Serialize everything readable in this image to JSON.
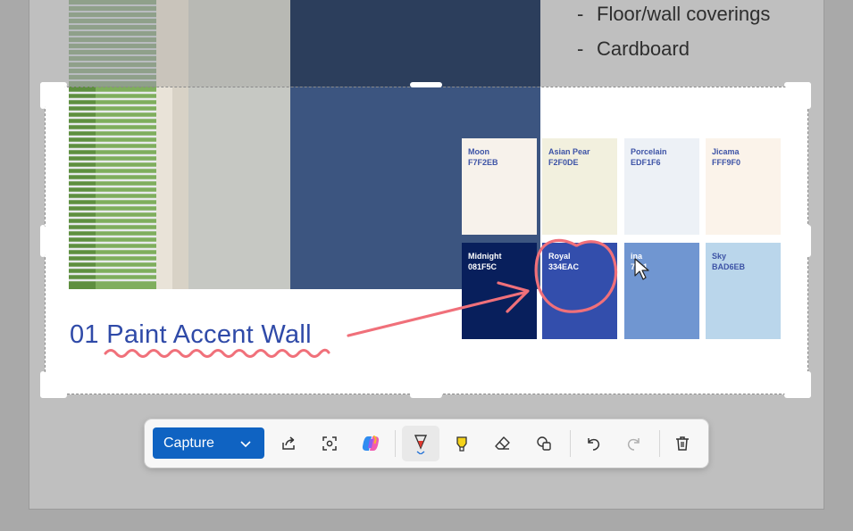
{
  "document": {
    "bullets": [
      {
        "dash": "-",
        "text": "Floor/wall coverings"
      },
      {
        "dash": "-",
        "text": "Cardboard"
      }
    ]
  },
  "selection": {
    "heading": "01 Paint Accent Wall",
    "swatches": [
      {
        "name": "Moon",
        "hex": "F7F2EB",
        "color": "#f7f2eb",
        "text_color": "#3d53a6"
      },
      {
        "name": "Asian Pear",
        "hex": "F2F0DE",
        "color": "#f2f0de",
        "text_color": "#3d53a6"
      },
      {
        "name": "Porcelain",
        "hex": "EDF1F6",
        "color": "#edf1f6",
        "text_color": "#3d53a6"
      },
      {
        "name": "Jicama",
        "hex": "FFF9F0",
        "color": "#fbf3ea",
        "text_color": "#3d53a6"
      },
      {
        "name": "Midnight",
        "hex": "081F5C",
        "color": "#081f5c",
        "text_color": "#ffffff"
      },
      {
        "name": "Royal",
        "hex": "334EAC",
        "color": "#334eac",
        "text_color": "#ffffff"
      },
      {
        "name": "ina",
        "hex": "7  D1",
        "color": "#7096d1",
        "text_color": "#ffffff"
      },
      {
        "name": "Sky",
        "hex": "BAD6EB",
        "color": "#bad6eb",
        "text_color": "#3d53a6"
      }
    ]
  },
  "toolbar": {
    "capture_label": "Capture",
    "buttons": [
      "share-icon",
      "visual-search-icon",
      "copilot-icon",
      "pen-icon",
      "highlighter-icon",
      "eraser-icon",
      "shapes-icon",
      "undo-icon",
      "redo-icon",
      "delete-icon"
    ]
  },
  "colors": {
    "accent": "#0f63c2",
    "annotation": "#f0707a",
    "heading": "#2f4aa8"
  }
}
